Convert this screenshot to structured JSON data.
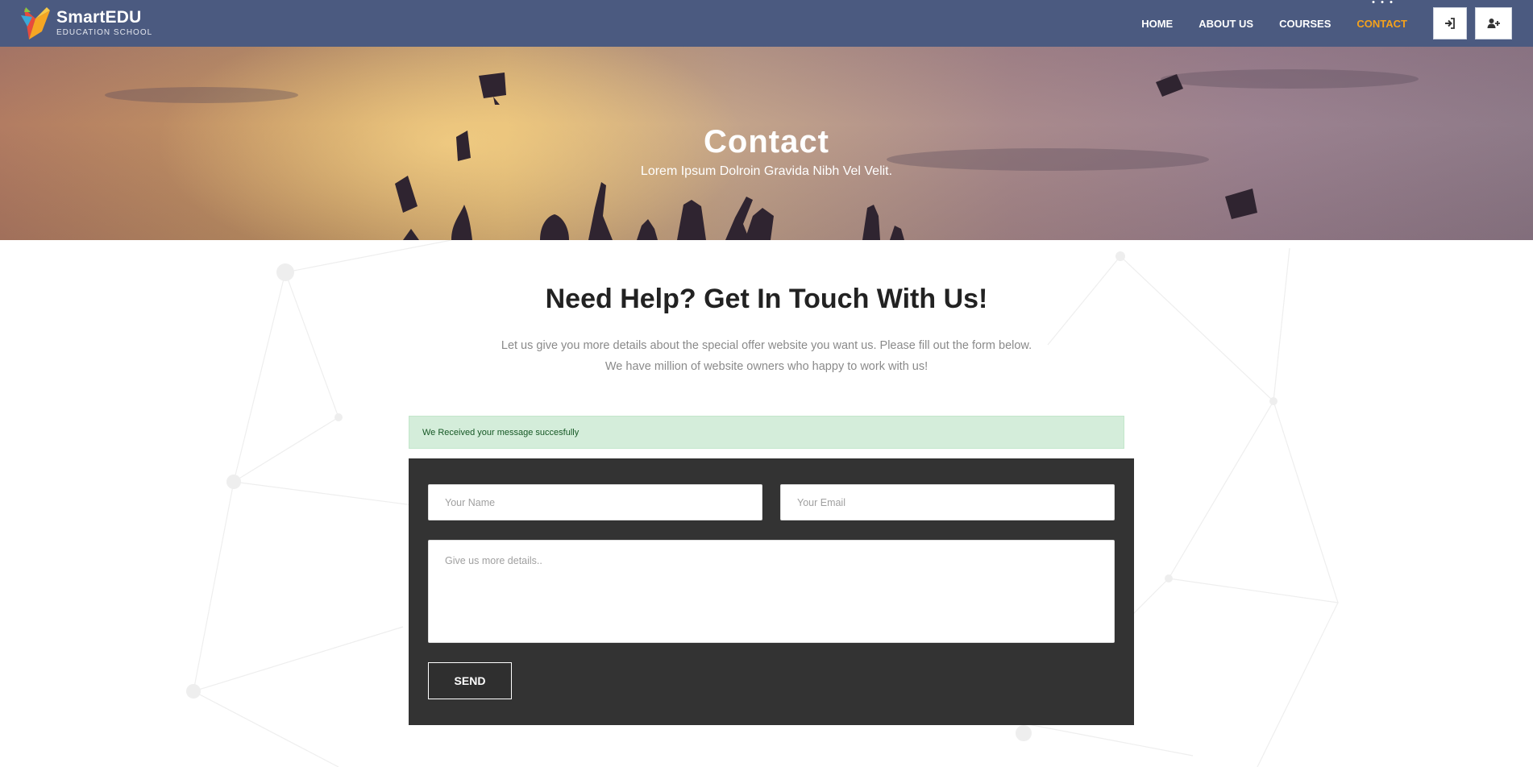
{
  "brand": {
    "title": "SmartEDU",
    "subtitle": "EDUCATION SCHOOL"
  },
  "nav": {
    "items": [
      {
        "label": "HOME",
        "active": false
      },
      {
        "label": "ABOUT US",
        "active": false
      },
      {
        "label": "COURSES",
        "active": false
      },
      {
        "label": "CONTACT",
        "active": true
      }
    ],
    "login_icon": "sign-in-icon",
    "register_icon": "user-plus-icon"
  },
  "hero": {
    "title": "Contact",
    "subtitle": "Lorem Ipsum Dolroin Gravida Nibh Vel Velit."
  },
  "section": {
    "title": "Need Help? Get In Touch With Us!",
    "desc_line1": "Let us give you more details about the special offer website you want us. Please fill out the form below.",
    "desc_line2": "We have million of website owners who happy to work with us!"
  },
  "alert": {
    "message": "We Received your message succesfully"
  },
  "form": {
    "name_placeholder": "Your Name",
    "email_placeholder": "Your Email",
    "details_placeholder": "Give us more details..",
    "send_label": "SEND"
  },
  "colors": {
    "header_bg": "#4b5a80",
    "accent": "#f6a21a",
    "form_bg": "#333333",
    "alert_bg": "#d4edda",
    "alert_text": "#155724"
  }
}
